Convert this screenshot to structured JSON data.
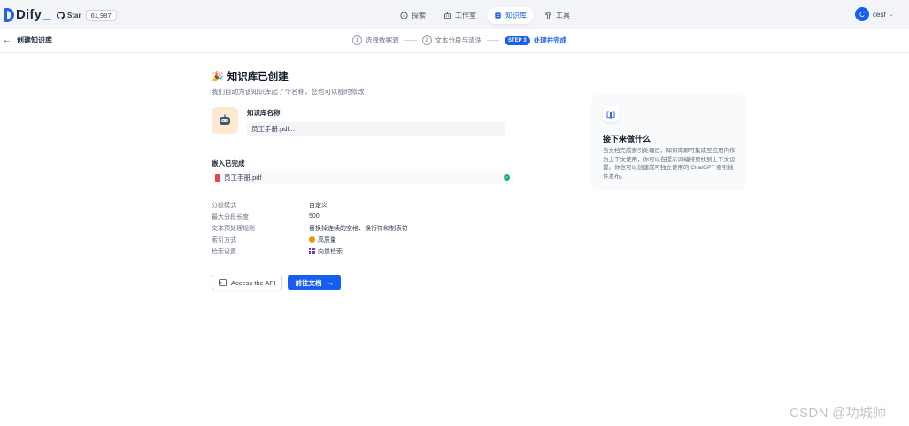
{
  "brand": {
    "name": "Dify",
    "accent": "#155eef"
  },
  "github": {
    "label": "Star",
    "count": "61,987"
  },
  "nav": {
    "items": [
      {
        "label": "探索",
        "icon": "compass-icon"
      },
      {
        "label": "工作室",
        "icon": "robot-icon"
      },
      {
        "label": "知识库",
        "icon": "database-icon",
        "active": true
      },
      {
        "label": "工具",
        "icon": "tool-icon"
      }
    ]
  },
  "user": {
    "initial": "C",
    "name": "cesf"
  },
  "stepbar": {
    "back_label": "创建知识库",
    "steps": [
      {
        "num": "1",
        "label": "选择数据源"
      },
      {
        "num": "2",
        "label": "文本分段与清洗"
      },
      {
        "num": "STEP 3",
        "label": "处理并完成",
        "active": true
      }
    ]
  },
  "main": {
    "title": "知识库已创建",
    "subtitle": "我们自动为该知识库起了个名称，您也可以随时修改",
    "kb_name_label": "知识库名称",
    "kb_name_value": "员工手册.pdf...",
    "embed_label": "嵌入已完成",
    "file_name": "员工手册.pdf",
    "info": [
      {
        "key": "分段模式",
        "value": "自定义"
      },
      {
        "key": "最大分段长度",
        "value": "500"
      },
      {
        "key": "文本预处理规则",
        "value": "替换掉连续的空格、换行符和制表符"
      },
      {
        "key": "索引方式",
        "value": "高质量",
        "icon": "orange"
      },
      {
        "key": "检索设置",
        "value": "向量检索",
        "icon": "grid"
      }
    ],
    "api_button": "Access the API",
    "go_button": "前往文档"
  },
  "card": {
    "title": "接下来做什么",
    "body": "当文档完成索引处理后，知识库即可集成至应用内作为上下文使用，你可以在提示词编排页找到上下文设置。你也可以创建成可独立使用的 ChatGPT 索引插件发布。"
  },
  "watermark": "CSDN @功城师"
}
